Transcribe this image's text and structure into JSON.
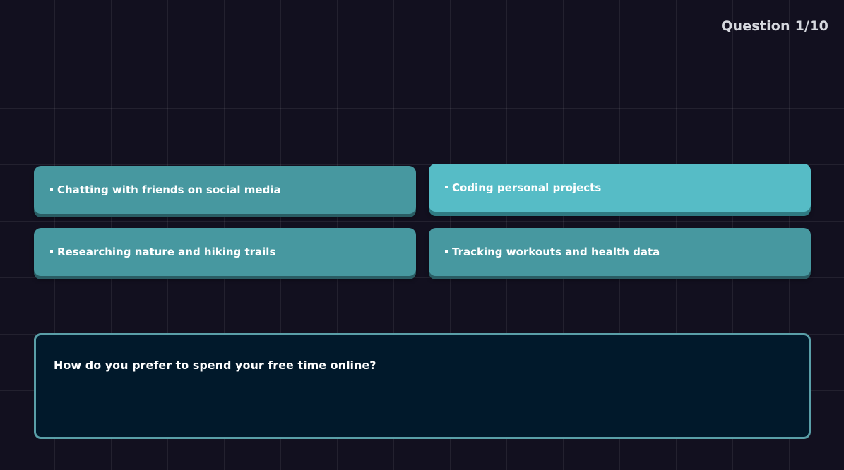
{
  "header": {
    "counter_text": "Question 1/10"
  },
  "options": [
    {
      "label": "Chatting with friends on social media",
      "selected": false
    },
    {
      "label": "Coding personal projects",
      "selected": true
    },
    {
      "label": "Researching nature and hiking trails",
      "selected": false
    },
    {
      "label": "Tracking workouts and health data",
      "selected": false
    }
  ],
  "question": {
    "text": "How do you prefer to spend your free time online?"
  },
  "colors": {
    "background": "#12101f",
    "option": "#4798a0",
    "option_selected": "#56bcc6",
    "question_box": "#01192b",
    "question_border": "#5a9fa8"
  }
}
